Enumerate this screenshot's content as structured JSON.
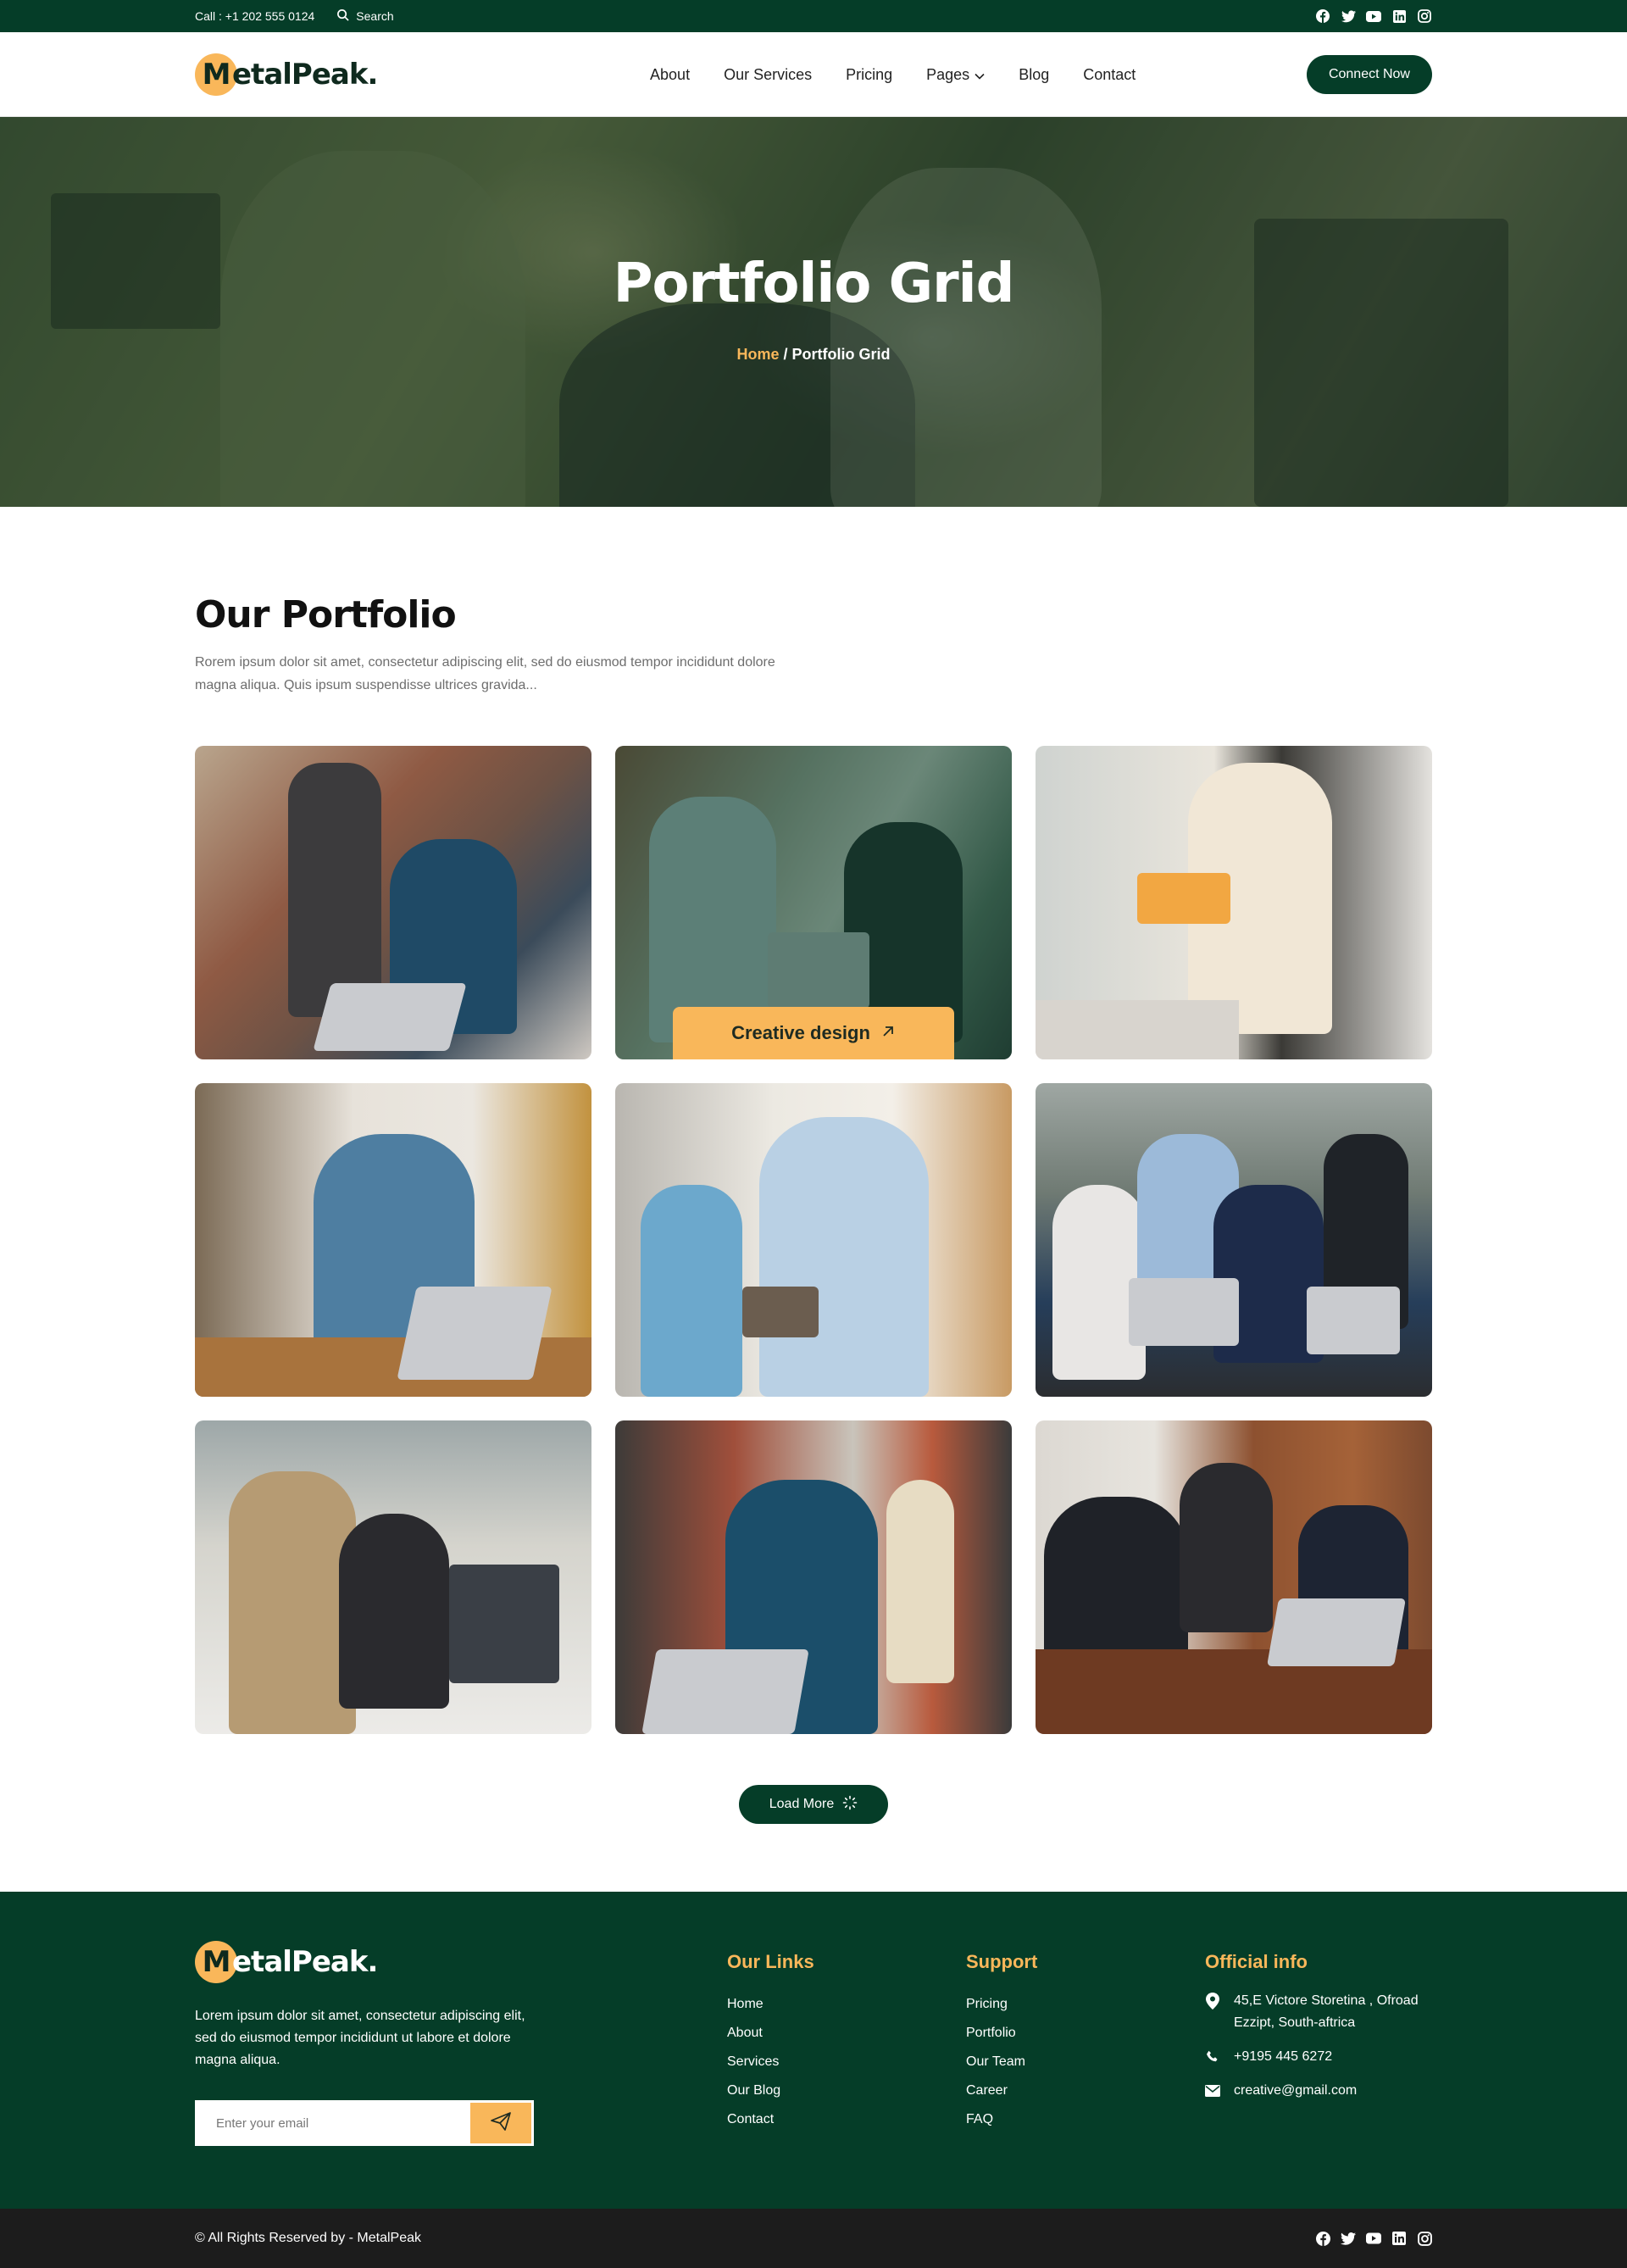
{
  "topbar": {
    "call": "Call : +1 202 555 0124",
    "search_label": "Search",
    "social": [
      "facebook-icon",
      "twitter-icon",
      "youtube-icon",
      "linkedin-icon",
      "instagram-icon"
    ]
  },
  "brand": {
    "logo_letter": "M",
    "logo_rest": "etalPeak."
  },
  "nav": {
    "items": [
      "About",
      "Our Services",
      "Pricing",
      "Pages",
      "Blog",
      "Contact"
    ],
    "cta": "Connect Now"
  },
  "hero": {
    "title": "Portfolio Grid",
    "crumb_home": "Home",
    "crumb_sep": " / ",
    "crumb_current": "Portfolio Grid"
  },
  "portfolio": {
    "title": "Our Portfolio",
    "description": "Rorem ipsum dolor sit amet, consectetur adipiscing elit, sed do eiusmod tempor incididunt dolore magna aliqua. Quis ipsum suspendisse ultrices gravida...",
    "hover_tag": "Creative design",
    "load_more": "Load More"
  },
  "footer": {
    "about": "Lorem ipsum dolor sit amet, consectetur adipiscing elit, sed do eiusmod tempor incididunt ut labore et dolore magna aliqua.",
    "email_placeholder": "Enter your email",
    "links_title": "Our Links",
    "links": [
      "Home",
      "About",
      "Services",
      "Our Blog",
      "Contact"
    ],
    "support_title": "Support",
    "support": [
      "Pricing",
      "Portfolio",
      "Our Team",
      "Career",
      "FAQ"
    ],
    "info_title": "Official info",
    "address": "45,E Victore Storetina , Ofroad Ezzipt, South-aftrica",
    "phone": "+9195 445 6272",
    "email": "creative@gmail.com",
    "copyright": "© All Rights Reserved by - MetalPeak"
  },
  "colors": {
    "primary": "#053d28",
    "accent": "#f9b75a",
    "bottom": "#1c1c1c"
  }
}
